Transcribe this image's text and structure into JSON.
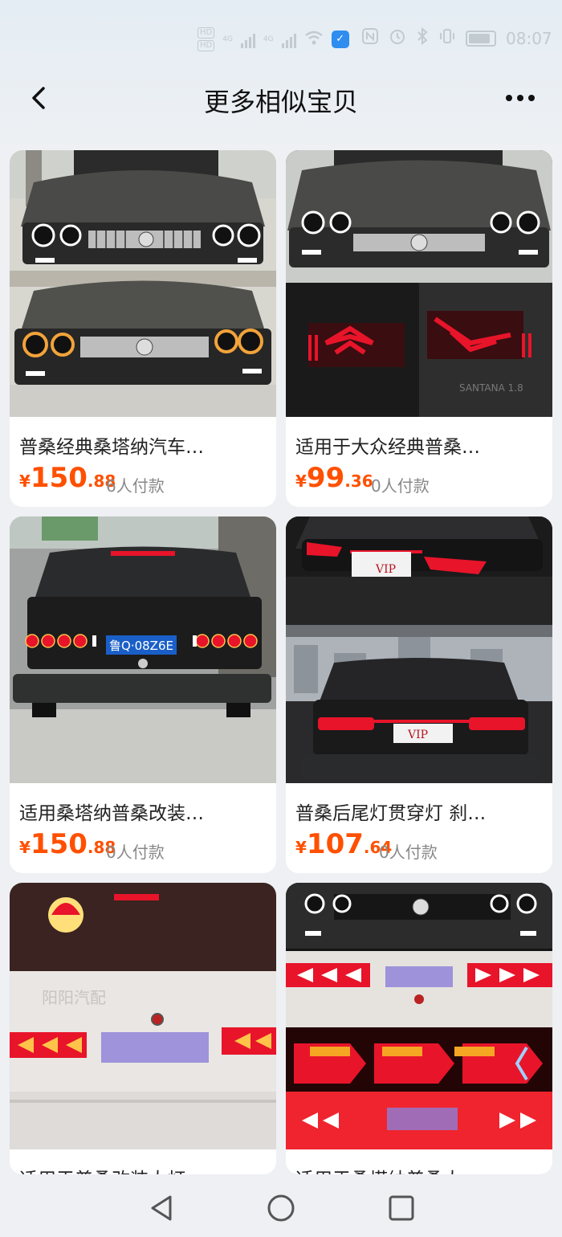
{
  "status": {
    "hd1": "HD",
    "hd2": "HD",
    "net1": "4G",
    "net2": "4G",
    "time": "08:07"
  },
  "header": {
    "title": "更多相似宝贝"
  },
  "products": [
    {
      "name": "普桑经典桑塔纳汽车…",
      "currency": "¥",
      "price_int": "150",
      "price_dec": ".88",
      "sold": "6人付款"
    },
    {
      "name": "适用于大众经典普桑…",
      "currency": "¥",
      "price_int": "99",
      "price_dec": ".36",
      "sold": "0人付款"
    },
    {
      "name": "适用桑塔纳普桑改装…",
      "currency": "¥",
      "price_int": "150",
      "price_dec": ".88",
      "sold": "0人付款"
    },
    {
      "name": "普桑后尾灯贯穿灯 刹…",
      "currency": "¥",
      "price_int": "107",
      "price_dec": ".64",
      "sold": "0人付款"
    },
    {
      "name": "适用于普桑改装大灯",
      "currency": "¥",
      "price_int": "",
      "price_dec": "",
      "sold": ""
    },
    {
      "name": "适用于桑塔纳普桑大",
      "currency": "¥",
      "price_int": "",
      "price_dec": "",
      "sold": ""
    }
  ],
  "images": {
    "plate_3": "鲁Q·08Z6E",
    "vip": "VIP",
    "santana": "SANTANA 1.8",
    "watermark": "阳阳汽配"
  },
  "colors": {
    "price": "#ff5000",
    "page_bg": "#eef0f3",
    "tail_red": "#e8142a"
  }
}
